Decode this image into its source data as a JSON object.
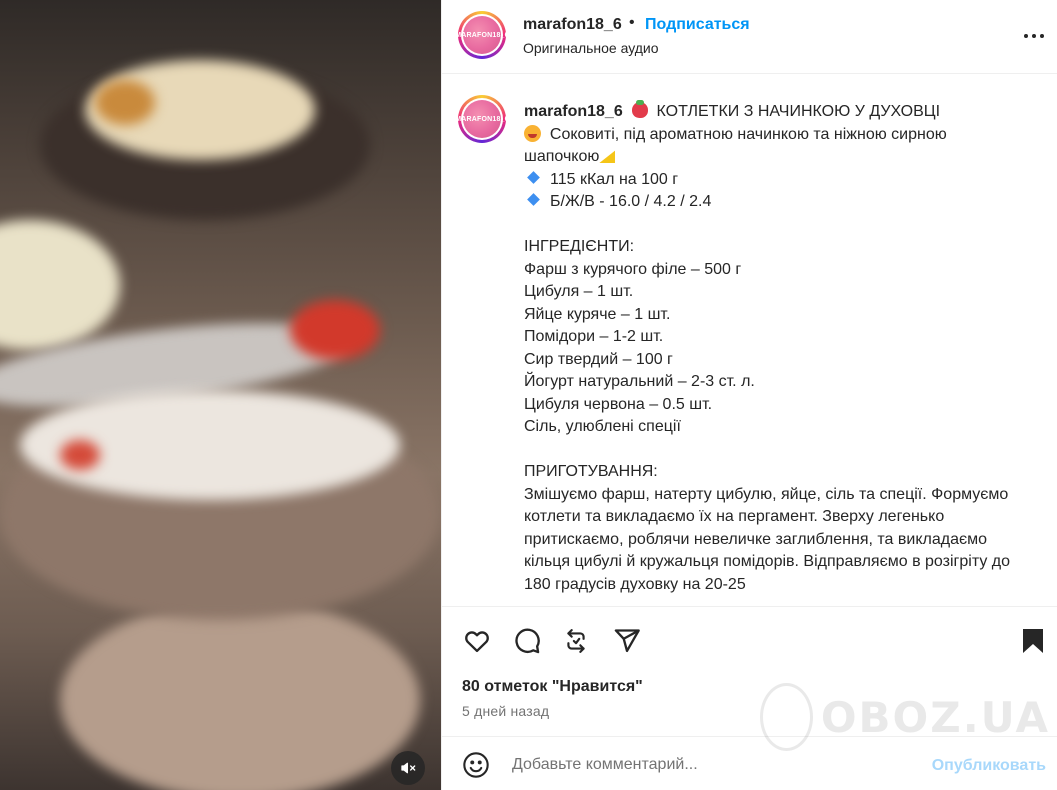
{
  "post": {
    "username": "marafon18_6",
    "avatar_text": "MARAFON18_6",
    "follow_label": "Подписаться",
    "separator": "•",
    "audio_label": "Оригинальное аудио",
    "likes_text": "80 отметок \"Нравится\"",
    "date_text": "5 дней назад"
  },
  "caption": {
    "username": "marafon18_6",
    "title": "КОТЛЕТКИ З НАЧИНКОЮ У ДУХОВЦІ",
    "line_intro": "Соковиті, під ароматною начинкою та ніжною сирною шапочкою",
    "kcal": "115 кКал на 100 г",
    "bju": "Б/Ж/В - 16.0 / 4.2 / 2.4",
    "ingredients_header": "ІНГРЕДІЄНТИ:",
    "ingredients": [
      "Фарш з курячого філе – 500 г",
      "Цибуля – 1 шт.",
      "Яйце куряче – 1 шт.",
      "Помідори – 1-2 шт.",
      "Сир твердий – 100 г",
      "Йогурт натуральний – 2-3 ст. л.",
      "Цибуля червона – 0.5 шт.",
      "Сіль, улюблені спеції"
    ],
    "steps_header": "ПРИГОТУВАННЯ:",
    "steps": "Змішуємо фарш, натерту цибулю, яйце, сіль та спеції. Формуємо котлети та викладаємо їх на пергамент. Зверху легенько притискаємо, роблячи невеличке заглиблення, та викладаємо кільця цибулі й кружальця помідорів. Відправляємо в розігріту до 180 градусів духовку на 20-25"
  },
  "comment": {
    "placeholder": "Добавьте комментарий...",
    "publish_label": "Опубликовать"
  },
  "watermark": {
    "text": "OBOZ.UA"
  },
  "icons": {
    "like": "heart-icon",
    "comment": "comment-icon",
    "repost": "repost-icon",
    "share": "send-icon",
    "save": "bookmark-icon",
    "more": "more-icon",
    "mute": "muted-speaker-icon",
    "emoji": "emoji-icon"
  },
  "colors": {
    "link_blue": "#0095f6",
    "publish_disabled": "#a8d8fb",
    "text": "#262626",
    "secondary_text": "#737373"
  }
}
